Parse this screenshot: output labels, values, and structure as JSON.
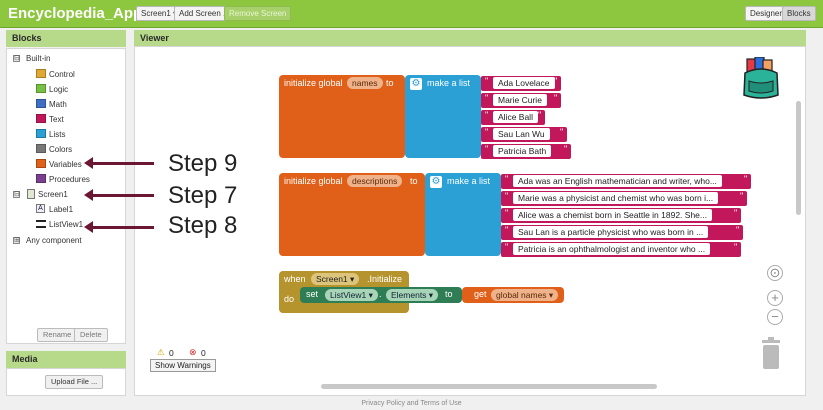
{
  "app": {
    "title": "Encyclopedia_App",
    "screen_dropdown": "Screen1 ▾",
    "add_screen": "Add Screen ...",
    "remove_screen": "Remove Screen",
    "designer": "Designer",
    "blocks": "Blocks"
  },
  "blocks_panel": {
    "title": "Blocks",
    "builtin_label": "Built-in",
    "builtin_toggle": "⊟",
    "items": [
      {
        "label": "Control",
        "color": "#e0a832"
      },
      {
        "label": "Logic",
        "color": "#77c043"
      },
      {
        "label": "Math",
        "color": "#3f6fc4"
      },
      {
        "label": "Text",
        "color": "#c2185b"
      },
      {
        "label": "Lists",
        "color": "#2aa0d4"
      },
      {
        "label": "Colors",
        "color": "#777777"
      },
      {
        "label": "Variables",
        "color": "#e0601a"
      },
      {
        "label": "Procedures",
        "color": "#7b3f8f"
      }
    ],
    "screen_label": "Screen1",
    "screen_toggle": "⊟",
    "label1": "Label1",
    "listview1": "ListView1",
    "any_component": "Any component",
    "any_toggle": "⊞",
    "rename_button": "Rename",
    "delete_button": "Delete"
  },
  "media_panel": {
    "title": "Media",
    "upload_button": "Upload File ..."
  },
  "viewer": {
    "title": "Viewer",
    "warnings_count": "0",
    "errors_count": "0",
    "show_warnings": "Show Warnings"
  },
  "steps": {
    "step9": "Step 9",
    "step7": "Step 7",
    "step8": "Step 8"
  },
  "code": {
    "names_block": {
      "init_text": "initialize global",
      "var_name": "names",
      "to_text": "to",
      "make_list": "make a list",
      "items": [
        "Ada Lovelace",
        "Marie Curie",
        "Alice Ball",
        "Sau Lan Wu",
        "Patricia Bath"
      ]
    },
    "descriptions_block": {
      "init_text": "initialize global",
      "var_name": "descriptions",
      "to_text": "to",
      "make_list": "make a list",
      "items": [
        "Ada was an English mathematician and writer, who...",
        "Marie was a physicist and chemist who was born i...",
        "Alice was a chemist born in Seattle in 1892. She...",
        "Sau Lan is a particle physicist who was born in ...",
        "Patricia is an ophthalmologist and inventor who ..."
      ]
    },
    "event_block": {
      "when_text": "when",
      "component": "Screen1 ▾",
      "event": ".Initialize",
      "do_text": "do",
      "set_text": "set",
      "set_component": "ListView1 ▾",
      "dot": ".",
      "property": "Elements ▾",
      "to_text": "to",
      "get_text": "get",
      "get_var": "global names ▾"
    }
  },
  "quote_char": "\"",
  "footer": "Privacy Policy and Terms of Use"
}
